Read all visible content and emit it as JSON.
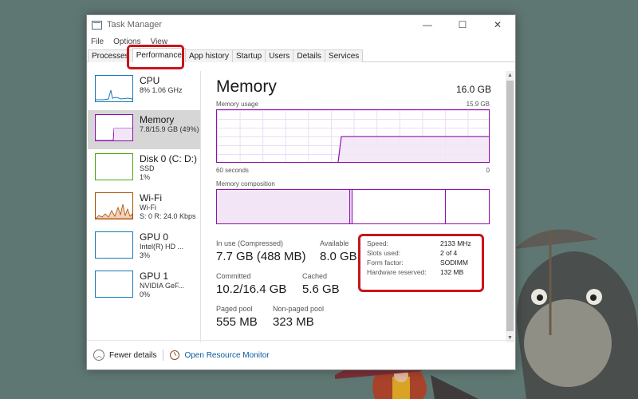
{
  "window": {
    "title": "Task Manager",
    "controls": {
      "minimize": "—",
      "maximize": "☐",
      "close": "✕"
    }
  },
  "menu": [
    "File",
    "Options",
    "View"
  ],
  "tabs": [
    "Processes",
    "Performance",
    "App history",
    "Startup",
    "Users",
    "Details",
    "Services"
  ],
  "active_tab": "Performance",
  "sidebar": {
    "items": [
      {
        "title": "CPU",
        "sub1": "8% 1.06 GHz",
        "sub2": "",
        "sub3": ""
      },
      {
        "title": "Memory",
        "sub1": "7.8/15.9 GB (49%)",
        "sub2": "",
        "sub3": ""
      },
      {
        "title": "Disk 0 (C: D:)",
        "sub1": "SSD",
        "sub2": "1%",
        "sub3": ""
      },
      {
        "title": "Wi-Fi",
        "sub1": "Wi-Fi",
        "sub2": "S: 0 R: 24.0 Kbps",
        "sub3": ""
      },
      {
        "title": "GPU 0",
        "sub1": "Intel(R) HD ...",
        "sub2": "3%",
        "sub3": ""
      },
      {
        "title": "GPU 1",
        "sub1": "NVIDIA GeF...",
        "sub2": "0%",
        "sub3": ""
      }
    ]
  },
  "main": {
    "title": "Memory",
    "total": "16.0 GB",
    "usage_label": "Memory usage",
    "usage_max": "15.9 GB",
    "time_left": "60 seconds",
    "time_right": "0",
    "composition_label": "Memory composition",
    "usage_fraction": 0.49
  },
  "stats": {
    "in_use": {
      "label": "In use (Compressed)",
      "value": "7.7 GB (488 MB)"
    },
    "available": {
      "label": "Available",
      "value": "8.0 GB"
    },
    "committed": {
      "label": "Committed",
      "value": "10.2/16.4 GB"
    },
    "cached": {
      "label": "Cached",
      "value": "5.6 GB"
    },
    "paged_pool": {
      "label": "Paged pool",
      "value": "555 MB"
    },
    "non_paged_pool": {
      "label": "Non-paged pool",
      "value": "323 MB"
    }
  },
  "hardware": {
    "speed": {
      "label": "Speed:",
      "value": "2133 MHz"
    },
    "slots": {
      "label": "Slots used:",
      "value": "2 of 4"
    },
    "form": {
      "label": "Form factor:",
      "value": "SODIMM"
    },
    "reserved": {
      "label": "Hardware reserved:",
      "value": "132 MB"
    }
  },
  "footer": {
    "fewer_details": "Fewer details",
    "open_resource_monitor": "Open Resource Monitor"
  },
  "colors": {
    "memory_accent": "#8b12ae",
    "cpu_accent": "#1779ba",
    "disk_accent": "#4da60c",
    "wifi_accent": "#a74f01",
    "highlight": "#c8151d"
  }
}
